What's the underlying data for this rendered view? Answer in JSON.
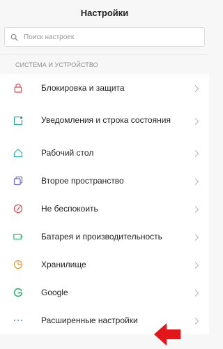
{
  "header": {
    "title": "Настройки"
  },
  "search": {
    "placeholder": "Поиск настроек",
    "icon": "search-icon"
  },
  "section": {
    "label": "СИСТЕМА И УСТРОЙСТВО"
  },
  "items": [
    {
      "label": "Блокировка и защита",
      "icon": "lock-icon",
      "color": "#e14a4a"
    },
    {
      "label": "Уведомления и строка состояния",
      "icon": "notification-icon",
      "color": "#1aa89a"
    },
    {
      "label": "Рабочий стол",
      "icon": "home-icon",
      "color": "#26b5b0"
    },
    {
      "label": "Второе пространство",
      "icon": "dual-space-icon",
      "color": "#6b6ad8"
    },
    {
      "label": "Не беспокоить",
      "icon": "do-not-disturb-icon",
      "color": "#e14a4a"
    },
    {
      "label": "Батарея и производительность",
      "icon": "battery-icon",
      "color": "#2bb673"
    },
    {
      "label": "Хранилище",
      "icon": "storage-icon",
      "color": "#f29a2e"
    },
    {
      "label": "Google",
      "icon": "google-icon",
      "color": "#2bb673"
    },
    {
      "label": "Расширенные настройки",
      "icon": "more-icon",
      "color": "#3d8fe0"
    }
  ],
  "annotation": {
    "arrow_color": "#e3161b"
  }
}
